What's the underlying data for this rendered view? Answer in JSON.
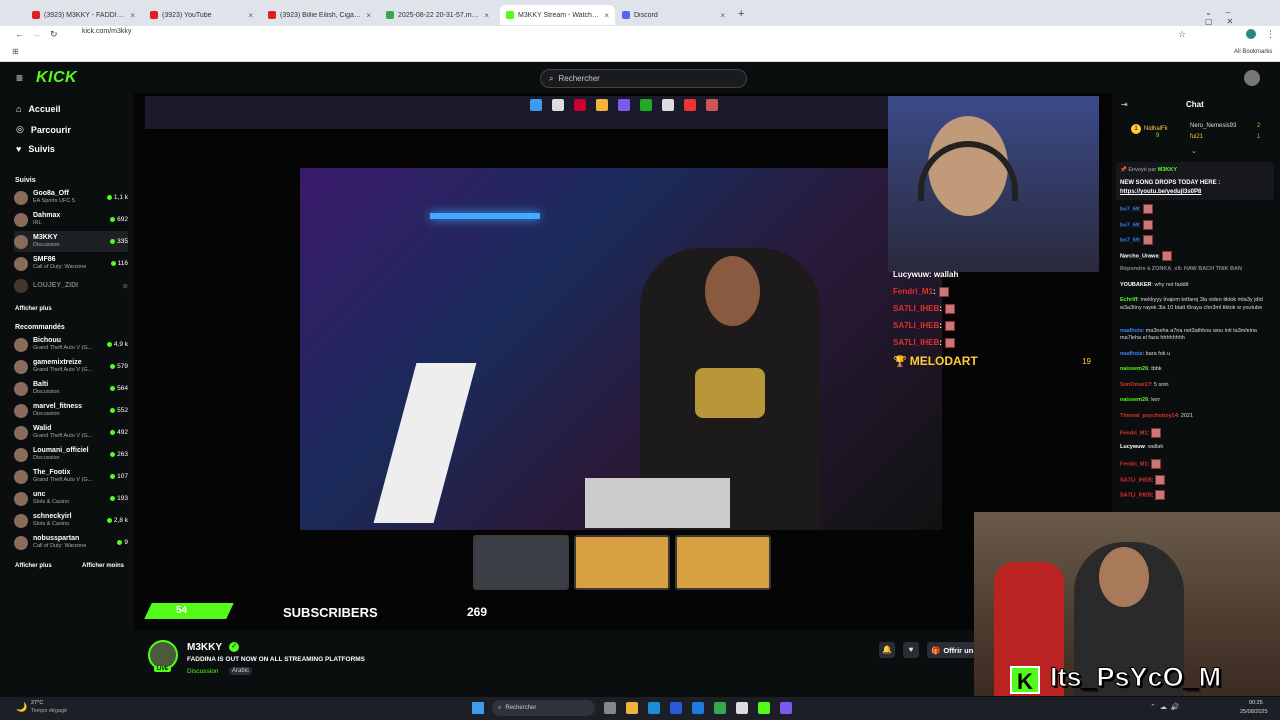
{
  "browser": {
    "tabs": [
      {
        "title": "(3923) M3KKY - FADDINA ليه",
        "active": false,
        "color": "#e02020"
      },
      {
        "title": "(3923) YouTube",
        "active": false,
        "color": "#e02020"
      },
      {
        "title": "(3923) Billie Eilish, Cigarettes Af",
        "active": false,
        "color": "#e02020"
      },
      {
        "title": "2025-08-22 20-31-57.mkv - Go",
        "active": false,
        "color": "#34a853"
      },
      {
        "title": "M3KKY Stream - Watch Live on",
        "active": true,
        "color": "#53fc18"
      },
      {
        "title": "Discord",
        "active": false,
        "color": "#5865f2"
      }
    ],
    "url": "kick.com/m3kky",
    "all_bookmarks": "All Bookmarks"
  },
  "header": {
    "logo": "KICK",
    "search_placeholder": "Rechercher"
  },
  "sidebar": {
    "nav": [
      {
        "label": "Accueil",
        "icon": "home-icon"
      },
      {
        "label": "Parcourir",
        "icon": "compass-icon"
      },
      {
        "label": "Suivis",
        "icon": "heart-icon"
      }
    ],
    "followed_title": "Suivis",
    "followed": [
      {
        "name": "Goo8a_Off",
        "category": "EA Sports UFC 5",
        "viewers": "1,1 k"
      },
      {
        "name": "Dahmax",
        "category": "IRL",
        "viewers": "692"
      },
      {
        "name": "M3KKY",
        "category": "Discussion",
        "viewers": "335"
      },
      {
        "name": "SMF86",
        "category": "Call of Duty: Warzone",
        "viewers": "116"
      },
      {
        "name": "LOUJEY_ZIDI",
        "category": "",
        "viewers": ""
      }
    ],
    "show_more": "Afficher plus",
    "recommended_title": "Recommandés",
    "recommended": [
      {
        "name": "Bichouu",
        "category": "Grand Theft Auto V (G...",
        "viewers": "4,9 k"
      },
      {
        "name": "gamemixtreize",
        "category": "Grand Theft Auto V (G...",
        "viewers": "579"
      },
      {
        "name": "Balti",
        "category": "Discussion",
        "viewers": "564"
      },
      {
        "name": "marvel_fitness",
        "category": "Discussion",
        "viewers": "552"
      },
      {
        "name": "Walid",
        "category": "Grand Theft Auto V (G...",
        "viewers": "492"
      },
      {
        "name": "Loumani_officiel",
        "category": "Discussion",
        "viewers": "263"
      },
      {
        "name": "The_Footix",
        "category": "Grand Theft Auto V (G...",
        "viewers": "107"
      },
      {
        "name": "unc",
        "category": "Slots & Casino",
        "viewers": "193"
      },
      {
        "name": "schneckyirl",
        "category": "Slots & Casino",
        "viewers": "2,8 k"
      },
      {
        "name": "nobusspartan",
        "category": "Call of Duty: Warzone",
        "viewers": "9"
      }
    ],
    "show_more2": "Afficher plus",
    "show_less": "Afficher moins"
  },
  "player": {
    "overlay_chat": [
      {
        "user": "Lucywuw",
        "msg": ": wallah",
        "color": "#ffffff"
      },
      {
        "user": "Fendri_M1",
        "msg": ":",
        "color": "#e0302a"
      },
      {
        "user": "SA7LI_IHEB",
        "msg": ":",
        "color": "#e0302a"
      },
      {
        "user": "SA7LI_IHEB",
        "msg": ":",
        "color": "#e0302a"
      },
      {
        "user": "SA7LI_IHEB",
        "msg": ":",
        "color": "#e0302a"
      }
    ],
    "top_gifter": "MELODART",
    "top_gifter_count": "19",
    "sub_count": "54",
    "sub_label": "SUBSCRIBERS",
    "sub_goal": "269",
    "watermark": "Its_PsYcO_M"
  },
  "stream_info": {
    "channel": "M3KKY",
    "title": "FADDINA IS OUT NOW ON ALL STREAMING PLATFORMS",
    "category": "Discussion",
    "tag": "Arabic",
    "live_badge": "LIVE",
    "gift_button": "Offrir un"
  },
  "chat": {
    "title": "Chat",
    "leaderboard": [
      {
        "name": "NidhalFk",
        "count": "9"
      },
      {
        "name": "Nero_Nemesis93",
        "count": "2"
      },
      {
        "name": "fui21",
        "count": "1"
      }
    ],
    "pinned_by": "Envoyé par",
    "pinned_user": "M3KKY",
    "pinned_text": "NEW SONG DROPS TODAY HERE :",
    "pinned_link": "https://youtu.be/yedujl3s0P8",
    "messages": [
      {
        "user": "bo7_69",
        "text": ":",
        "color": "#3b82f6",
        "emote": true
      },
      {
        "user": "bo7_69",
        "text": ":",
        "color": "#3b82f6",
        "emote": true
      },
      {
        "user": "bo7_69",
        "text": ":",
        "color": "#3b82f6",
        "emote": true
      },
      {
        "user": "Narcho_Urawa",
        "text": ":",
        "color": "#ffffff",
        "emote": true
      },
      {
        "user": "Répondre à ZONKA_x9: HAW BACH TNIK BAN",
        "text": "",
        "color": "#888888",
        "emote": false
      },
      {
        "user": "YOUBAKER",
        "text": ": why not faddit",
        "color": "#ffffff",
        "emote": false
      },
      {
        "user": "Echriff",
        "text": ": mekkyyy tnajem tetfarej 3la video tiktok mta3y jdid w3a3tiny rayek 3la 10 btalt t9raya chn3ml tiktok w youtube",
        "color": "#53fc18",
        "emote": false
      },
      {
        "user": "madhoia",
        "text": ": ma3neha a7na net3athbou wou inti ta3mleina ma7leha el faza hhhhhhhh",
        "color": "#3b82f6",
        "emote": false
      },
      {
        "user": "madhoia",
        "text": ": bara fok u",
        "color": "#3b82f6",
        "emote": false
      },
      {
        "user": "naissem26",
        "text": ": tbbk",
        "color": "#53fc18",
        "emote": false
      },
      {
        "user": "SonOmar27",
        "text": ": 5 snin",
        "color": "#e0302a",
        "emote": false
      },
      {
        "user": "naissem26",
        "text": ": lwrr",
        "color": "#53fc18",
        "emote": false
      },
      {
        "user": "Thereal_psychoboy14",
        "text": ": 2021",
        "color": "#e0302a",
        "emote": false
      },
      {
        "user": "Fendri_M1",
        "text": ":",
        "color": "#e0302a",
        "emote": true
      },
      {
        "user": "Lucywuw",
        "text": ": wallah",
        "color": "#ffffff",
        "emote": false
      },
      {
        "user": "Fendri_M1",
        "text": ":",
        "color": "#e0302a",
        "emote": true
      },
      {
        "user": "SA7LI_IHEB",
        "text": ":",
        "color": "#e0302a",
        "emote": true
      },
      {
        "user": "SA7LI_IHEB",
        "text": ":",
        "color": "#e0302a",
        "emote": true
      },
      {
        "user": "SA7LI_IHEB",
        "text": ":",
        "color": "#e0302a",
        "emote": true
      }
    ]
  },
  "taskbar": {
    "weather_temp": "27°C",
    "weather_desc": "Temps dégagé",
    "search": "Rechercher",
    "time": "00:25",
    "date": "25/08/2025"
  },
  "colors": {
    "accent": "#53fc18",
    "background": "#0b0e0f"
  }
}
